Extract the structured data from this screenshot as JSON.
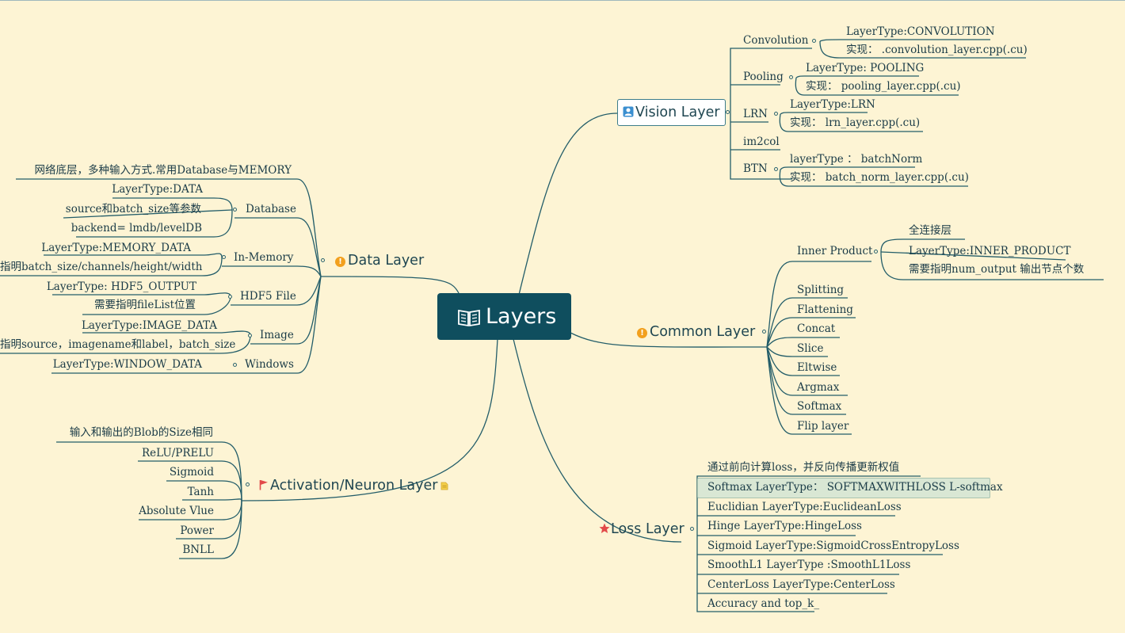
{
  "central": {
    "title": "Layers",
    "icon": "book-icon"
  },
  "vision": {
    "title": "Vision Layer",
    "icon": "person-badge-icon",
    "convolution": {
      "label": "Convolution",
      "type": "LayerType:CONVOLUTION",
      "impl": "实现： .convolution_layer.cpp(.cu)"
    },
    "pooling": {
      "label": "Pooling",
      "type": "LayerType: POOLING",
      "impl": "实现： pooling_layer.cpp(.cu)"
    },
    "lrn": {
      "label": "LRN",
      "type": "LayerType:LRN",
      "impl": "实现： lrn_layer.cpp(.cu)"
    },
    "im2col": {
      "label": "im2col"
    },
    "btn": {
      "label": "BTN",
      "type": "layerType ： batchNorm",
      "impl": "实现： batch_norm_layer.cpp(.cu)"
    }
  },
  "common": {
    "title": "Common Layer",
    "icon": "exclamation-icon",
    "inner_product": {
      "label": "Inner Product",
      "children": [
        "全连接层",
        "LayerType:INNER_PRODUCT",
        "需要指明num_output 输出节点个数"
      ]
    },
    "items": [
      "Splitting",
      "Flattening",
      "Concat",
      "Slice",
      "Eltwise",
      "Argmax",
      "Softmax",
      "Flip layer"
    ]
  },
  "loss": {
    "title": "Loss Layer",
    "icon": "star-icon",
    "items": [
      "通过前向计算loss，并反向传播更新权值",
      "Softmax LayerType： SOFTMAXWITHLOSS L-softmax",
      "Euclidian  LayerType:EuclideanLoss",
      "Hinge LayerType:HingeLoss",
      "Sigmoid LayerType:SigmoidCrossEntropyLoss",
      "SmoothL1 LayerType :SmoothL1Loss",
      "CenterLoss  LayerType:CenterLoss",
      "Accuracy and top_k_"
    ]
  },
  "data_layer": {
    "title": "Data Layer",
    "icon": "exclamation-icon",
    "desc": "网络底层，多种输入方式.常用Database与MEMORY",
    "database": {
      "label": "Database",
      "children": [
        "LayerType:DATA",
        "source和batch_size等参数",
        "backend= lmdb/levelDB"
      ]
    },
    "in_memory": {
      "label": "In-Memory",
      "children": [
        "LayerType:MEMORY_DATA",
        "指明batch_size/channels/height/width"
      ]
    },
    "hdf5": {
      "label": "HDF5 File",
      "children": [
        "LayerType: HDF5_OUTPUT",
        "需要指明fileList位置"
      ]
    },
    "image": {
      "label": "Image",
      "children": [
        "LayerType:IMAGE_DATA",
        "指明source，imagename和label，batch_size"
      ]
    },
    "windows": {
      "label": "Windows",
      "children": [
        "LayerType:WINDOW_DATA"
      ]
    }
  },
  "activation": {
    "title": "Activation/Neuron Layer",
    "icon": "flag-icon",
    "note_icon": "note-icon",
    "items": [
      "输入和输出的Blob的Size相同",
      "ReLU/PRELU",
      "Sigmoid",
      "Tanh",
      "Absolute Vlue",
      "Power",
      "BNLL"
    ]
  },
  "colors": {
    "background": "#fdf4d4",
    "central": "#0f4e5e",
    "line": "#235d69",
    "warn": "#f2a01e",
    "flag": "#e24a4a",
    "highlight": "#d9e7d4"
  }
}
